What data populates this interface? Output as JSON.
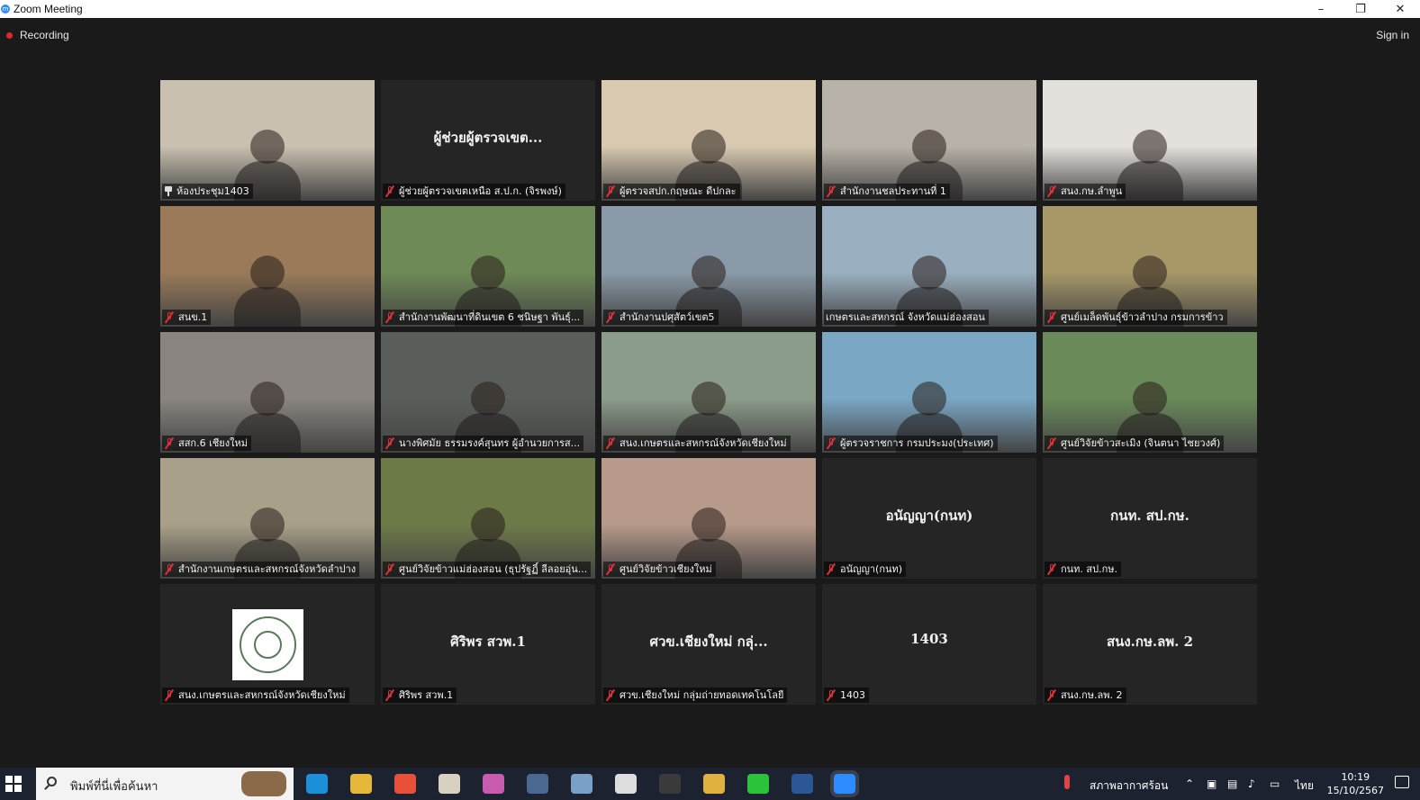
{
  "window": {
    "title": "Zoom Meeting",
    "app_icon": "zoom-icon"
  },
  "topbar": {
    "recording": "Recording",
    "sign_in": "Sign in"
  },
  "gallery": {
    "tiles": [
      {
        "name": "ห้องประชุม1403",
        "center": "",
        "muted": false,
        "pinned": true,
        "video": true,
        "tone": "#c9c0b0"
      },
      {
        "name": "ผู้ช่วยผู้ตรวจเขตเหนือ ส.ป.ก. (จิรพงษ์)",
        "center": "ผู้ช่วยผู้ตรวจเขต...",
        "muted": true,
        "video": false
      },
      {
        "name": "ผู้ตรวจสปก.กฤษณะ ดีปกละ",
        "center": "",
        "muted": true,
        "video": true,
        "tone": "#d8c9b0"
      },
      {
        "name": "สำนักงานชลประทานที่ 1",
        "center": "",
        "muted": true,
        "video": true,
        "tone": "#b8b2a8"
      },
      {
        "name": "สนง.กษ.ลำพูน",
        "center": "",
        "muted": true,
        "video": true,
        "tone": "#e4e0dc"
      },
      {
        "name": "สนข.1",
        "center": "",
        "muted": true,
        "video": true,
        "tone": "#9a7a58"
      },
      {
        "name": "สำนักงานพัฒนาที่ดินเขต 6 ชนิษฐา พันธุ์...",
        "center": "",
        "muted": true,
        "video": true,
        "tone": "#6e8a56"
      },
      {
        "name": "สำนักงานปศุสัตว์เขต5",
        "center": "",
        "muted": true,
        "video": true,
        "tone": "#8a9aa8"
      },
      {
        "name": "เกษตรและสหกรณ์ จังหวัดแม่ฮ่องสอน",
        "center": "",
        "muted": false,
        "video": true,
        "tone": "#9ab0c0",
        "active": true
      },
      {
        "name": "ศูนย์เมล็ดพันธุ์ข้าวลำปาง กรมการข้าว",
        "center": "",
        "muted": true,
        "video": true,
        "tone": "#a89868"
      },
      {
        "name": "สสก.6 เชียงใหม่",
        "center": "",
        "muted": true,
        "video": true,
        "tone": "#8a8580"
      },
      {
        "name": "นางพิศมัย ธรรมรงค์สุนทร ผู้อำนวยการส...",
        "center": "",
        "muted": true,
        "video": true,
        "tone": "#5a5e5a"
      },
      {
        "name": "สนง.เกษตรและสหกรณ์จังหวัดเชียงใหม่",
        "center": "",
        "muted": true,
        "video": true,
        "tone": "#8c9c8a"
      },
      {
        "name": "ผู้ตรวจราชการ กรมประมง(ประเทศ)",
        "center": "",
        "muted": true,
        "video": true,
        "tone": "#7aa8c4"
      },
      {
        "name": "ศูนย์วิจัยข้าวสะเมิง (จินตนา ไชยวงศ์)",
        "center": "",
        "muted": true,
        "video": true,
        "tone": "#6a8a5a"
      },
      {
        "name": "สำนักงานเกษตรและสหกรณ์จังหวัดลำปาง",
        "center": "",
        "muted": true,
        "video": true,
        "tone": "#a8a088"
      },
      {
        "name": "ศูนย์วิจัยข้าวแม่ฮ่องสอน (ธุปรัฐฏิ์ ลีลอยอุ่น...",
        "center": "",
        "muted": true,
        "video": true,
        "tone": "#6c7a48"
      },
      {
        "name": "ศูนย์วิจัยข้าวเชียงใหม่",
        "center": "",
        "muted": true,
        "video": true,
        "tone": "#b89a8a"
      },
      {
        "name": "อนัญญา(กนท)",
        "center": "อนัญญา(กนท)",
        "muted": true,
        "video": false
      },
      {
        "name": "กนท. สป.กษ.",
        "center": "กนท. สป.กษ.",
        "muted": true,
        "video": false
      },
      {
        "name": "สนง.เกษตรและสหกรณ์จังหวัดเชียงใหม่",
        "center": "",
        "muted": true,
        "video": false,
        "logo": true
      },
      {
        "name": "ศิริพร สวพ.1",
        "center": "ศิริพร สวพ.1",
        "muted": true,
        "video": false
      },
      {
        "name": "ศวข.เชียงใหม่ กลุ่มถ่ายทอดเทคโนโลยี",
        "center": "ศวข.เชียงใหม่ กลุ่...",
        "muted": true,
        "video": false
      },
      {
        "name": "1403",
        "center": "1403",
        "muted": true,
        "video": false
      },
      {
        "name": "สนง.กษ.ลพ. 2",
        "center": "สนง.กษ.ลพ. 2",
        "muted": true,
        "video": false
      }
    ]
  },
  "taskbar": {
    "search_placeholder": "พิมพ์ที่นี่เพื่อค้นหา",
    "weather": "สภาพอากาศร้อน",
    "language": "ไทย",
    "time": "10:19",
    "date": "15/10/2567",
    "apps": [
      "edge-icon",
      "chrome-icon",
      "drop-icon",
      "files-icon",
      "paint-icon",
      "calculator-icon",
      "notepad-icon",
      "camera-icon",
      "glasses-icon",
      "folder-icon",
      "line-icon",
      "word-icon",
      "zoom-icon"
    ]
  },
  "colors": {
    "accent_active": "#f1e34a",
    "mute": "#e0303a",
    "zoom_blue": "#2d8cff"
  }
}
